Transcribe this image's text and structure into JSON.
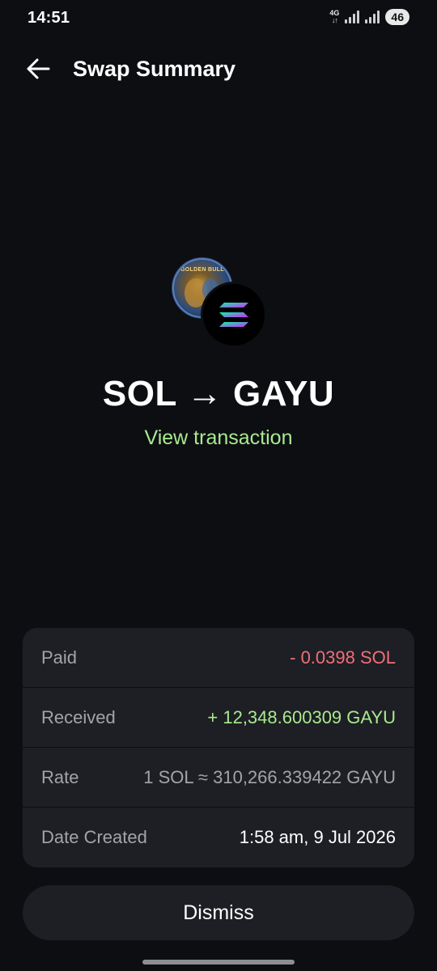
{
  "status_bar": {
    "time": "14:51",
    "network": "4G",
    "battery": "46"
  },
  "header": {
    "title": "Swap Summary",
    "back_icon": "arrow-left-icon"
  },
  "tokens": {
    "from_icon": "solana-logo",
    "to_icon": "golden-bull-logo",
    "to_icon_text": "GOLDEN BULL"
  },
  "swap": {
    "title": "SOL → GAYU",
    "view_transaction": "View transaction"
  },
  "details": [
    {
      "label": "Paid",
      "value": "- 0.0398 SOL",
      "tone": "negative"
    },
    {
      "label": "Received",
      "value": "+ 12,348.600309 GAYU",
      "tone": "positive"
    },
    {
      "label": "Rate",
      "value": "1 SOL ≈ 310,266.339422 GAYU",
      "tone": "muted"
    },
    {
      "label": "Date Created",
      "value": "1:58 am, 9 Jul 2026",
      "tone": "default"
    }
  ],
  "dismiss_label": "Dismiss",
  "colors": {
    "background": "#0d0e12",
    "card": "#1e1f24",
    "positive": "#a8ea8f",
    "negative": "#ef6f7a",
    "muted": "#a3a4a9"
  }
}
